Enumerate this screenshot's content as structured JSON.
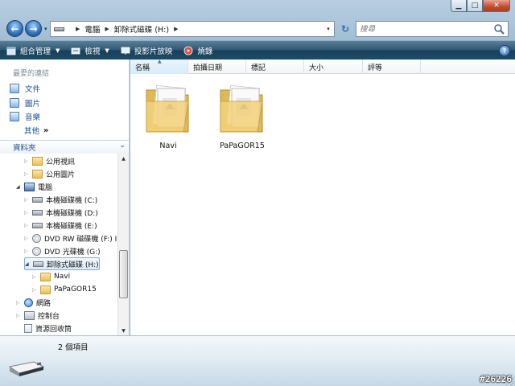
{
  "window": {
    "title": "",
    "caption": {
      "minimize": "▁",
      "maximize": "□",
      "close": "✕"
    }
  },
  "address_bar": {
    "history_arrow": "▾",
    "crumbs": [
      "電腦",
      "卸除式磁碟 (H:)"
    ],
    "dropdown": "▾",
    "refresh": "↻"
  },
  "search": {
    "placeholder": "搜尋"
  },
  "toolbar": {
    "organize": "組合管理",
    "views": "檢視",
    "slideshow": "投影片放映",
    "burn": "燒錄",
    "dropdown_arrow": "▼",
    "help": "?"
  },
  "nav_pane": {
    "favorites_title": "最愛的連結",
    "favorites": [
      "文件",
      "圖片",
      "音樂"
    ],
    "more": "其他",
    "more_chevron": "»",
    "folders_title": "資料夾",
    "folders_chevron": "⌄",
    "tree": [
      {
        "label": "公用視訊",
        "indent": 1,
        "icon": "public-video-folder-icon",
        "tri": "▷"
      },
      {
        "label": "公用圖片",
        "indent": 1,
        "icon": "public-pictures-folder-icon",
        "tri": "▷"
      },
      {
        "label": "電腦",
        "indent": 0,
        "icon": "computer-icon",
        "tri": "◢"
      },
      {
        "label": "本機磁碟機 (C:)",
        "indent": 1,
        "icon": "windows-drive-icon",
        "tri": "▷"
      },
      {
        "label": "本機磁碟機 (D:)",
        "indent": 1,
        "icon": "hard-drive-icon",
        "tri": "▷"
      },
      {
        "label": "本機磁碟機 (E:)",
        "indent": 1,
        "icon": "hard-drive-icon",
        "tri": "▷"
      },
      {
        "label": "DVD RW 磁碟機 (F:) I",
        "indent": 1,
        "icon": "dvd-rw-drive-icon",
        "tri": "▷"
      },
      {
        "label": "DVD 光碟機 (G:)",
        "indent": 1,
        "icon": "dvd-drive-icon",
        "tri": "▷"
      },
      {
        "label": "卸除式磁碟 (H:)",
        "indent": 1,
        "icon": "removable-drive-icon",
        "tri": "◢",
        "selected": true
      },
      {
        "label": "Navi",
        "indent": 2,
        "icon": "folder-icon",
        "tri": "▷"
      },
      {
        "label": "PaPaGOR15",
        "indent": 2,
        "icon": "folder-icon",
        "tri": "▷"
      },
      {
        "label": "網路",
        "indent": 0,
        "icon": "network-icon",
        "tri": "▷"
      },
      {
        "label": "控制台",
        "indent": 0,
        "icon": "control-panel-icon",
        "tri": "▷"
      },
      {
        "label": "資源回收筒",
        "indent": 0,
        "icon": "recycle-bin-icon",
        "tri": ""
      }
    ],
    "scroll": {
      "up": "▲",
      "down": "▼"
    }
  },
  "columns": [
    "名稱",
    "拍攝日期",
    "標記",
    "大小",
    "評等"
  ],
  "sort_indicator": "▲",
  "items": [
    {
      "name": "Navi"
    },
    {
      "name": "PaPaGOR15"
    }
  ],
  "status": {
    "count": "2 個項目"
  },
  "watermark": "#26226",
  "colors": {
    "toolbar": "#1e4c68",
    "link": "#1c4e8c",
    "folder": "#e6c25d",
    "selection_border": "#84acdd"
  }
}
